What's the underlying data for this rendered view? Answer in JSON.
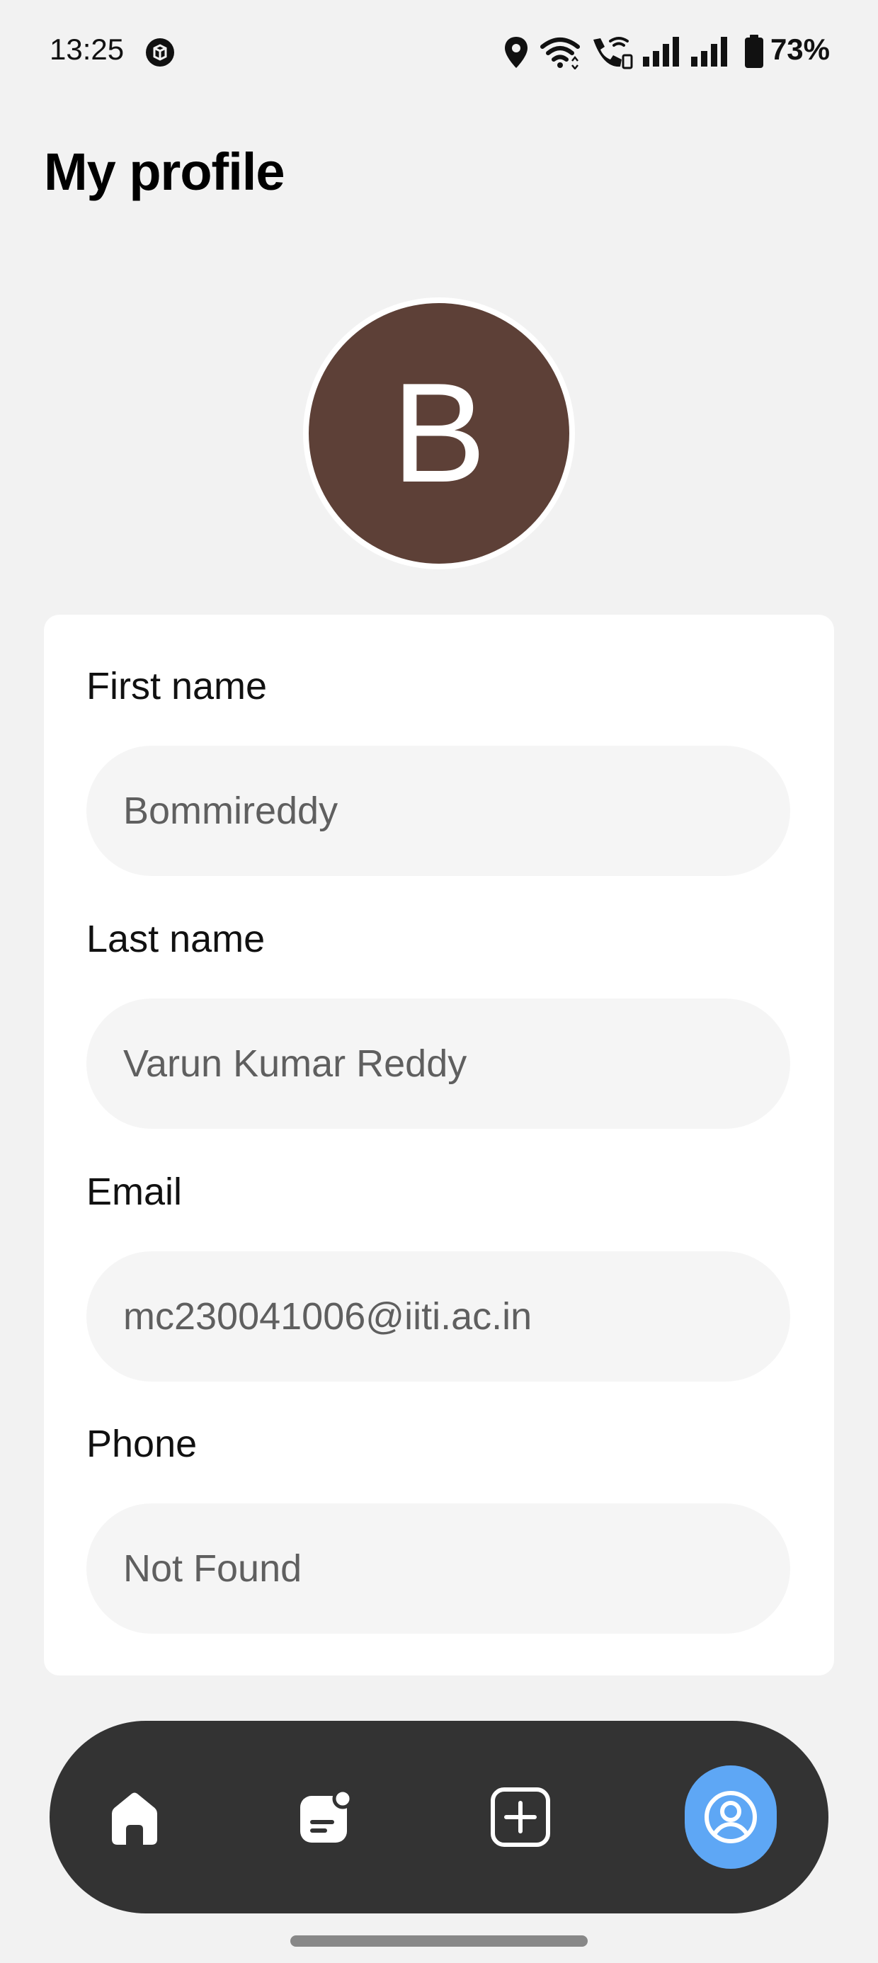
{
  "status_bar": {
    "time": "13:25",
    "battery": "73%",
    "icons": [
      "app-notification-icon",
      "location-icon",
      "wifi-icon",
      "wifi-calling-icon",
      "signal-icon",
      "signal-icon",
      "battery-icon"
    ]
  },
  "header": {
    "title": "My profile"
  },
  "avatar": {
    "initial": "B",
    "color": "#5d4037"
  },
  "profile": {
    "first_name_label": "First name",
    "first_name_value": "Bommireddy",
    "last_name_label": "Last name",
    "last_name_value": "Varun Kumar Reddy",
    "email_label": "Email",
    "email_value": "mc230041006@iiti.ac.in",
    "phone_label": "Phone",
    "phone_value": "Not Found"
  },
  "bottom_nav": {
    "items": [
      {
        "icon": "home-icon",
        "active": false
      },
      {
        "icon": "notes-icon",
        "active": false
      },
      {
        "icon": "add-icon",
        "active": false
      },
      {
        "icon": "profile-icon",
        "active": true
      }
    ],
    "accent": "#5ea7f5",
    "background": "#333333"
  }
}
